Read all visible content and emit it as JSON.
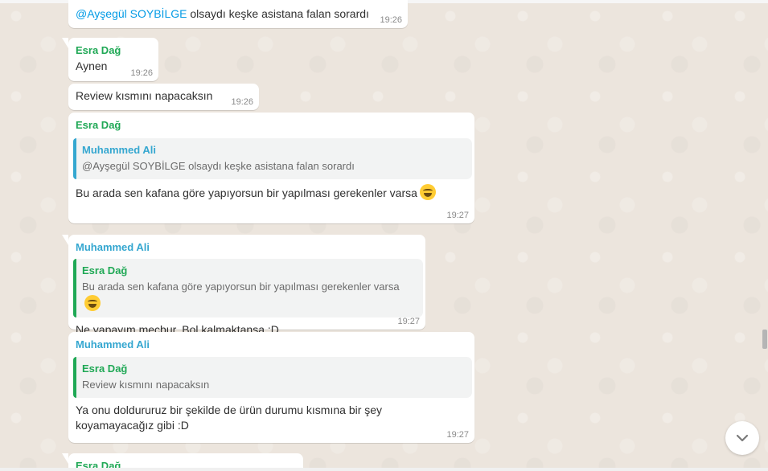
{
  "messages": [
    {
      "text_mention": "@Ayşegül SOYBİLGE",
      "text": " olsaydı keşke asistana falan sorardı",
      "time": "19:26"
    },
    {
      "sender": "Esra Dağ",
      "text": "Aynen",
      "time": "19:26"
    },
    {
      "text": "Review kısmını napacaksın",
      "time": "19:26"
    },
    {
      "sender": "Esra Dağ",
      "quote_name": "Muhammed Ali",
      "quote_text": "@Ayşegül SOYBİLGE olsaydı keşke asistana falan sorardı",
      "text": "Bu arada sen kafana göre yapıyorsun bir yapılması gerekenler varsa",
      "emoji": "face-with-tears-of-joy",
      "time": "19:27"
    },
    {
      "sender": "Muhammed Ali",
      "quote_name": "Esra Dağ",
      "quote_text": "Bu arada sen kafana göre yapıyorsun bir yapılması gerekenler varsa",
      "quote_emoji": "face-with-tears-of-joy",
      "text": "Ne yapayım mecbur. Bol kalmaktansa :D",
      "time": "19:27"
    },
    {
      "sender": "Muhammed Ali",
      "quote_name": "Esra Dağ",
      "quote_text": "Review kısmını napacaksın",
      "text": "Ya onu doldururuz bir şekilde de ürün durumu kısmına bir şey koyamayacağız gibi :D",
      "time": "19:27"
    },
    {
      "sender": "Esra Dağ"
    }
  ],
  "colors": {
    "esra": "#1fa855",
    "muhammed": "#35a7d0",
    "mention": "#039be5"
  },
  "icons": {
    "scroll_down": "chevron-down-icon"
  }
}
